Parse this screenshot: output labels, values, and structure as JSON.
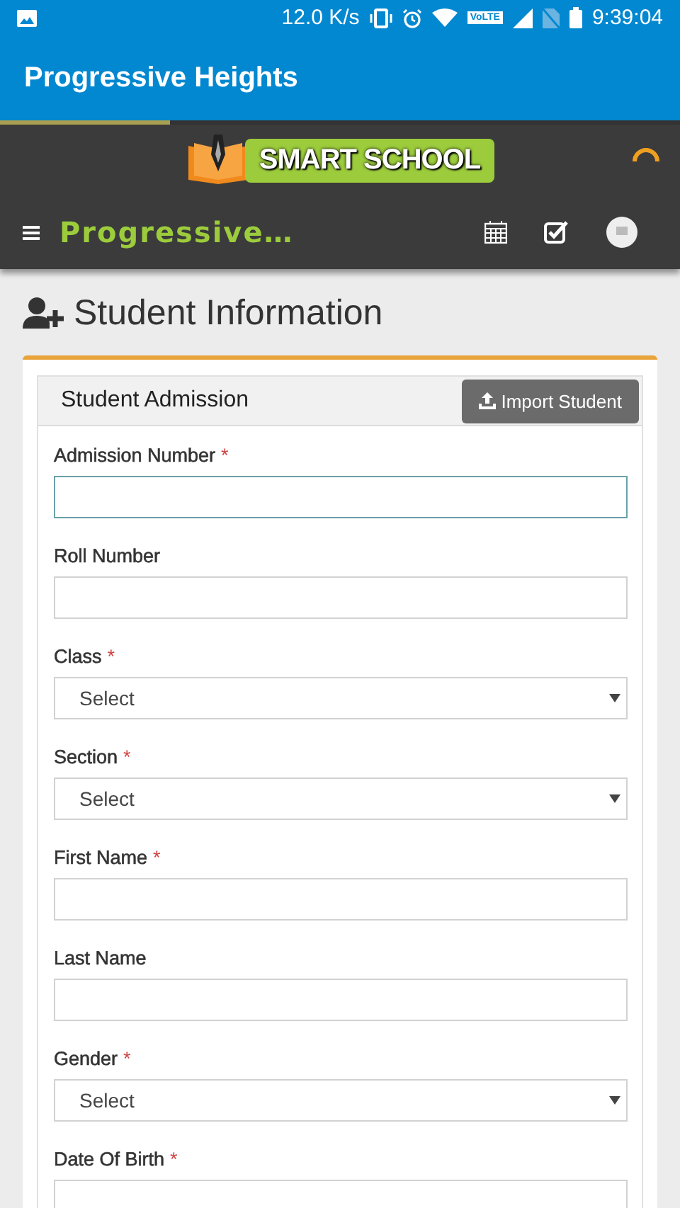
{
  "status_bar": {
    "speed": "12.0 K/s",
    "volte": "VoLTE",
    "time": "9:39:04"
  },
  "app_bar": {
    "title": "Progressive Heights"
  },
  "page_load": {
    "level": 0.25
  },
  "header": {
    "logo_text": "SMART SCHOOL",
    "school_name": "Progressive…"
  },
  "page_title": "Student Information",
  "card": {
    "title": "Student Admission",
    "import_button": "Import Student",
    "fields": [
      {
        "label": "Admission Number",
        "required_mark": "*",
        "kind": "text",
        "focused": true
      },
      {
        "label": "Roll Number",
        "kind": "text",
        "focused": false
      },
      {
        "label": "Class",
        "required_mark": "*",
        "kind": "select",
        "value": "Select",
        "focused": false
      },
      {
        "label": "Section",
        "required_mark": "*",
        "kind": "select",
        "value": "Select",
        "focused": false
      },
      {
        "label": "First Name",
        "required_mark": "*",
        "kind": "text",
        "focused": false
      },
      {
        "label": "Last Name",
        "kind": "text",
        "focused": false
      },
      {
        "label": "Gender",
        "required_mark": "*",
        "kind": "select",
        "value": "Select",
        "focused": false
      },
      {
        "label": "Date Of Birth",
        "required_mark": "*",
        "kind": "text",
        "focused": false
      }
    ]
  }
}
